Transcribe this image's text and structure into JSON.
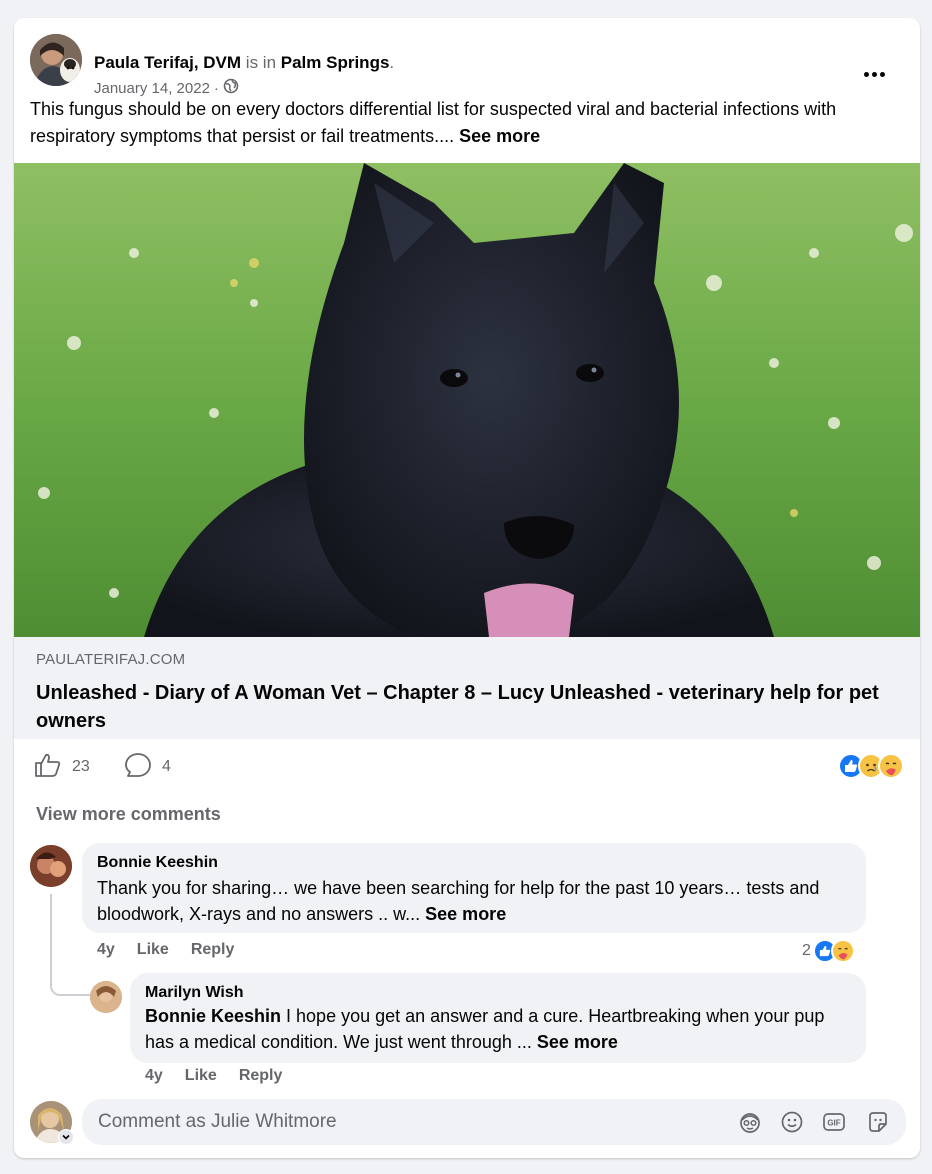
{
  "post": {
    "author": "Paula Terifaj, DVM",
    "is_in": "is in",
    "location": "Palm Springs",
    "period": ".",
    "date": "January 14, 2022",
    "separator": "·",
    "privacy_icon": "globe-icon",
    "more_icon": "more-horizontal-icon",
    "text": "This fungus should be on every doctors differential list for suspected viral and bacterial infections with respiratory symptoms that persist or fail treatments.... ",
    "see_more": "See more"
  },
  "link_preview": {
    "domain": "PAULATERIFAJ.COM",
    "title": "Unleashed - Diary of A Woman Vet – Chapter 8 – Lucy Unleashed - veterinary help for pet owners"
  },
  "stats": {
    "likes": "23",
    "comments": "4",
    "like_icon": "thumbs-up-icon",
    "comment_icon": "comment-bubble-icon",
    "reactions": [
      "like",
      "sad",
      "care"
    ]
  },
  "comments": {
    "view_more": "View more comments",
    "items": [
      {
        "name": "Bonnie Keeshin",
        "text": "Thank you for sharing… we have been searching for help for the past 10 years… tests and bloodwork, X-rays and no answers .. w... ",
        "see_more": "See more",
        "time": "4y",
        "like": "Like",
        "reply": "Reply",
        "reaction_count": "2",
        "reactions": [
          "like",
          "care"
        ]
      },
      {
        "name": "Marilyn Wish",
        "mention": "Bonnie Keeshin",
        "text": " I hope you get an answer and a cure. Heartbreaking when your pup has a medical condition. We just went through ... ",
        "see_more": "See more",
        "time": "4y",
        "like": "Like",
        "reply": "Reply"
      }
    ]
  },
  "composer": {
    "placeholder": "Comment as Julie Whitmore",
    "icons": [
      "avatar-sticker-icon",
      "emoji-icon",
      "gif-icon",
      "sticker-icon"
    ]
  },
  "colors": {
    "accent": "#1877f2",
    "muted": "#65676b",
    "bubble": "#f0f2f5"
  }
}
